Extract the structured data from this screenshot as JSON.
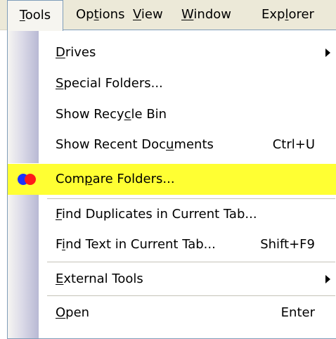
{
  "menubar": {
    "tools": {
      "u": "T",
      "rest": "ools"
    },
    "options": {
      "pre": "Op",
      "u": "t",
      "rest": "ions"
    },
    "view": {
      "u": "V",
      "rest": "iew"
    },
    "window": {
      "u": "W",
      "rest": "indow"
    },
    "explorer": {
      "pre": "Exp",
      "u": "l",
      "rest": "orer"
    }
  },
  "dropdown": {
    "drives": {
      "u": "D",
      "rest": "rives"
    },
    "special_folders": {
      "u": "S",
      "rest": "pecial Folders..."
    },
    "show_recycle_bin": {
      "pre": "Show Recy",
      "u": "c",
      "rest": "le Bin"
    },
    "show_recent_documents": {
      "pre": "Show Recent Doc",
      "u": "u",
      "rest": "ments",
      "shortcut": "Ctrl+U"
    },
    "compare_folders": {
      "pre": "Com",
      "u": "p",
      "rest": "are Folders..."
    },
    "find_duplicates": {
      "u": "F",
      "rest": "ind Duplicates in Current Tab..."
    },
    "find_text": {
      "pre": "F",
      "u": "i",
      "rest": "nd Text in Current Tab...",
      "shortcut": "Shift+F9"
    },
    "external_tools": {
      "u": "E",
      "rest": "xternal Tools"
    },
    "open": {
      "u": "O",
      "rest": "pen",
      "shortcut": "Enter"
    }
  }
}
